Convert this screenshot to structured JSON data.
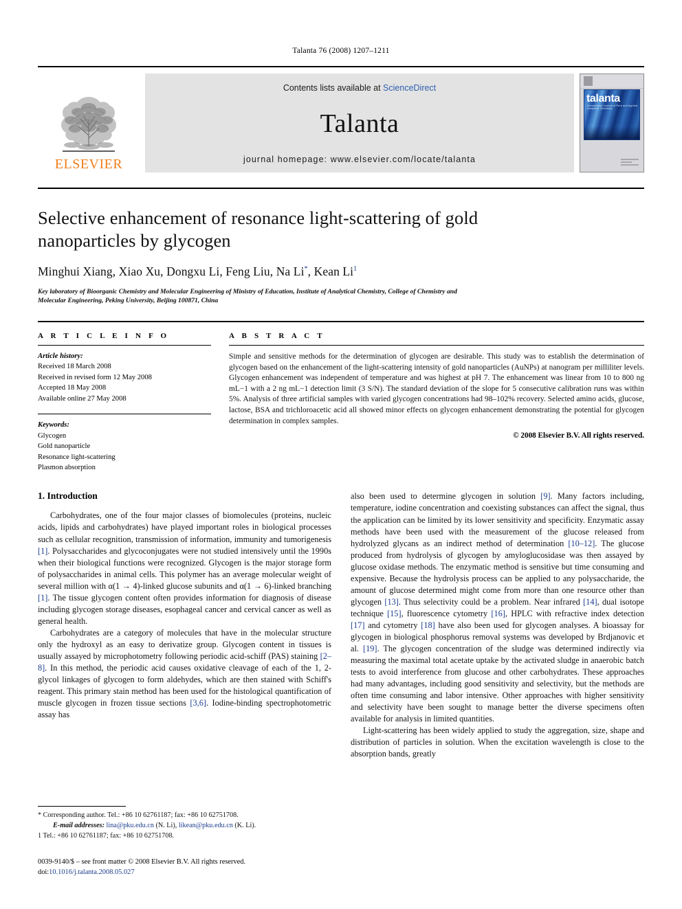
{
  "running_head": "Talanta 76 (2008) 1207–1211",
  "masthead": {
    "publisher": "ELSEVIER",
    "contents_prefix": "Contents lists available at ",
    "contents_link": "ScienceDirect",
    "journal_title": "Talanta",
    "homepage": "journal homepage: www.elsevier.com/locate/talanta",
    "cover_word": "talanta",
    "cover_subtitle": "International Journal of Pure and Applied Analytical Chemistry"
  },
  "article": {
    "title": "Selective enhancement of resonance light-scattering of gold nanoparticles by glycogen",
    "authors_text": "Minghui Xiang, Xiao Xu, Dongxu Li, Feng Liu, Na Li",
    "authors_tail": ", Kean Li",
    "corresponding_mark": "*",
    "author_footnote_mark": "1",
    "affiliation": "Key laboratory of Bioorganic Chemistry and Molecular Engineering of Ministry of Education, Institute of Analytical Chemistry, College of Chemistry and Molecular Engineering, Peking University, Beijing 100871, China"
  },
  "info": {
    "heading": "A R T I C L E   I N F O",
    "history_label": "Article history:",
    "history": [
      "Received 18 March 2008",
      "Received in revised form 12 May 2008",
      "Accepted 18 May 2008",
      "Available online 27 May 2008"
    ],
    "keywords_label": "Keywords:",
    "keywords": [
      "Glycogen",
      "Gold nanoparticle",
      "Resonance light-scattering",
      "Plasmon absorption"
    ]
  },
  "abstract": {
    "heading": "A B S T R A C T",
    "text": "Simple and sensitive methods for the determination of glycogen are desirable. This study was to establish the determination of glycogen based on the enhancement of the light-scattering intensity of gold nanoparticles (AuNPs) at nanogram per milliliter levels. Glycogen enhancement was independent of temperature and was highest at pH 7. The enhancement was linear from 10 to 800 ng mL−1 with a 2 ng mL−1 detection limit (3 S/N). The standard deviation of the slope for 5 consecutive calibration runs was within 5%. Analysis of three artificial samples with varied glycogen concentrations had 98–102% recovery. Selected amino acids, glucose, lactose, BSA and trichloroacetic acid all showed minor effects on glycogen enhancement demonstrating the potential for glycogen determination in complex samples.",
    "copyright": "© 2008 Elsevier B.V. All rights reserved."
  },
  "body": {
    "section_number_title": "1.  Introduction",
    "left_paragraphs": [
      "Carbohydrates, one of the four major classes of biomolecules (proteins, nucleic acids, lipids and carbohydrates) have played important roles in biological processes such as cellular recognition, transmission of information, immunity and tumorigenesis [1]. Polysaccharides and glycoconjugates were not studied intensively until the 1990s when their biological functions were recognized. Glycogen is the major storage form of polysaccharides in animal cells. This polymer has an average molecular weight of several million with α(1 → 4)-linked glucose subunits and α(1 → 6)-linked branching [1]. The tissue glycogen content often provides information for diagnosis of disease including glycogen storage diseases, esophageal cancer and cervical cancer as well as general health.",
      "Carbohydrates are a category of molecules that have in the molecular structure only the hydroxyl as an easy to derivatize group. Glycogen content in tissues is usually assayed by microphotometry following periodic acid-schiff (PAS) staining [2–8]. In this method, the periodic acid causes oxidative cleavage of each of the 1, 2-glycol linkages of glycogen to form aldehydes, which are then stained with Schiff's reagent. This primary stain method has been used for the histological quantification of muscle glycogen in frozen tissue sections [3,6]. Iodine-binding spectrophotometric assay has"
    ],
    "right_paragraphs": [
      "also been used to determine glycogen in solution [9]. Many factors including, temperature, iodine concentration and coexisting substances can affect the signal, thus the application can be limited by its lower sensitivity and specificity. Enzymatic assay methods have been used with the measurement of the glucose released from hydrolyzed glycans as an indirect method of determination [10–12]. The glucose produced from hydrolysis of glycogen by amyloglucosidase was then assayed by glucose oxidase methods. The enzymatic method is sensitive but time consuming and expensive. Because the hydrolysis process can be applied to any polysaccharide, the amount of glucose determined might come from more than one resource other than glycogen [13]. Thus selectivity could be a problem. Near infrared [14], dual isotope technique [15], fluorescence cytometry [16], HPLC with refractive index detection [17] and cytometry [18] have also been used for glycogen analyses. A bioassay for glycogen in biological phosphorus removal systems was developed by Brdjanovic et al. [19]. The glycogen concentration of the sludge was determined indirectly via measuring the maximal total acetate uptake by the activated sludge in anaerobic batch tests to avoid interference from glucose and other carbohydrates. These approaches had many advantages, including good sensitivity and selectivity, but the methods are often time consuming and labor intensive. Other approaches with higher sensitivity and selectivity have been sought to manage better the diverse specimens often available for analysis in limited quantities.",
      "Light-scattering has been widely applied to study the aggregation, size, shape and distribution of particles in solution. When the excitation wavelength is close to the absorption bands, greatly"
    ]
  },
  "footnotes": {
    "corresponding": "* Corresponding author. Tel.: +86 10 62761187; fax: +86 10 62751708.",
    "email_label": "E-mail addresses:",
    "email_1": "lina@pku.edu.cn",
    "email_1_name": "(N. Li),",
    "email_2": "likean@pku.edu.cn",
    "email_2_name": "(K. Li).",
    "footnote_1": "1  Tel.: +86 10 62761187; fax: +86 10 62751708.",
    "issn_line": "0039-9140/$ – see front matter © 2008 Elsevier B.V. All rights reserved.",
    "doi_label": "doi:",
    "doi_value": "10.1016/j.talanta.2008.05.027"
  }
}
